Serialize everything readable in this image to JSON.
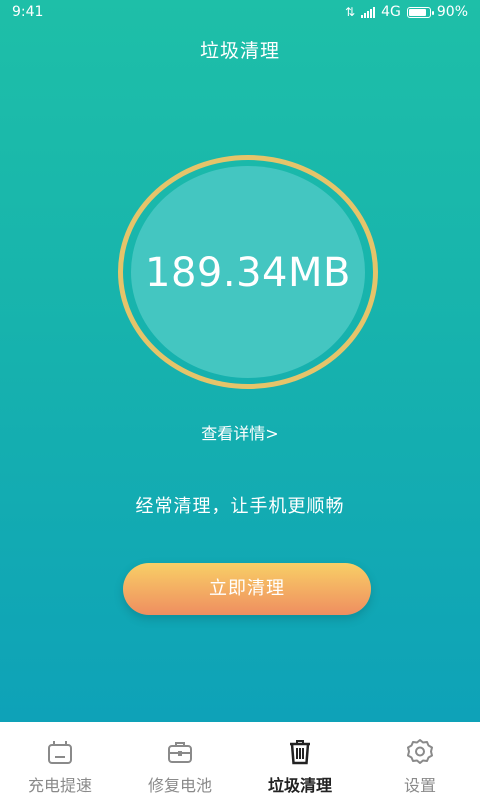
{
  "status_bar": {
    "time": "9:41",
    "network": "4G",
    "battery": "90%",
    "battery_level": 0.9
  },
  "header": {
    "title": "垃圾清理"
  },
  "junk": {
    "size": "189.34MB",
    "details_link": "查看详情>"
  },
  "tip": "经常清理，让手机更顺畅",
  "action": {
    "clean_label": "立即清理"
  },
  "colors": {
    "accent_ring": "#e5c46a",
    "button_top": "#f8cf66",
    "button_bottom": "#ef8e60",
    "bg_top": "#1ebfa8",
    "bg_bottom": "#0ea2b8"
  },
  "bottom_nav": {
    "items": [
      {
        "label": "充电提速",
        "icon": "charger-icon",
        "active": false
      },
      {
        "label": "修复电池",
        "icon": "toolbox-icon",
        "active": false
      },
      {
        "label": "垃圾清理",
        "icon": "trash-icon",
        "active": true
      },
      {
        "label": "设置",
        "icon": "gear-icon",
        "active": false
      }
    ]
  }
}
